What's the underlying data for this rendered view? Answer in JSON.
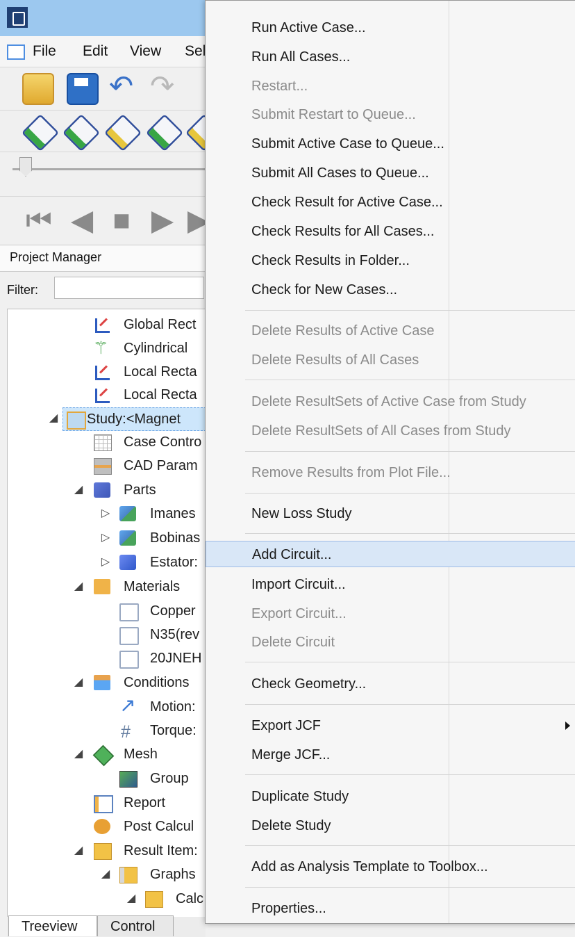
{
  "menubar": {
    "file": "File",
    "edit": "Edit",
    "view": "View",
    "select_partial": "Sel"
  },
  "project_manager": {
    "title": "Project Manager",
    "filter_label": "Filter:",
    "filter_value": ""
  },
  "tree": {
    "items": [
      "Global Rect",
      "Cylindrical",
      "Local Recta",
      "Local Recta",
      "Study:<Magnet",
      "Case Contro",
      "CAD Param",
      "Parts",
      "Imanes",
      "Bobinas",
      "Estator:",
      "Materials",
      "Copper",
      "N35(rev",
      "20JNEH",
      "Conditions",
      "Motion:",
      "Torque:",
      "Mesh",
      "Group",
      "Report",
      "Post Calcul",
      "Result Item:",
      "Graphs",
      "Calc"
    ]
  },
  "bottom_tabs": {
    "treeview": "Treeview",
    "control": "Control"
  },
  "context_menu": {
    "items": [
      "Run Active Case...",
      "Run All Cases...",
      "Restart...",
      "Submit Restart to Queue...",
      "Submit Active Case to Queue...",
      "Submit All Cases to Queue...",
      "Check Result for Active Case...",
      "Check Results for All Cases...",
      "Check Results in Folder...",
      "Check for New Cases...",
      "Delete Results of Active Case",
      "Delete Results of All Cases",
      "Delete ResultSets of Active Case from Study",
      "Delete ResultSets of All Cases from Study",
      "Remove Results from Plot File...",
      "New Loss Study",
      "Add Circuit...",
      "Import Circuit...",
      "Export Circuit...",
      "Delete Circuit",
      "Check Geometry...",
      "Export JCF",
      "Merge JCF...",
      "Duplicate Study",
      "Delete Study",
      "Add as Analysis Template to Toolbox...",
      "Properties..."
    ]
  },
  "colors": {
    "titlebar": "#9cc8ef",
    "menu_hover": "#d9e7f7",
    "disabled_text": "#8b8b8b"
  },
  "icons": {
    "file_menu": "document-icon",
    "open": "folder-open-icon",
    "save": "save-icon",
    "undo": "undo-icon",
    "redo": "redo-icon",
    "cube": "cube-icon",
    "submenu": "chevron-right-icon"
  }
}
